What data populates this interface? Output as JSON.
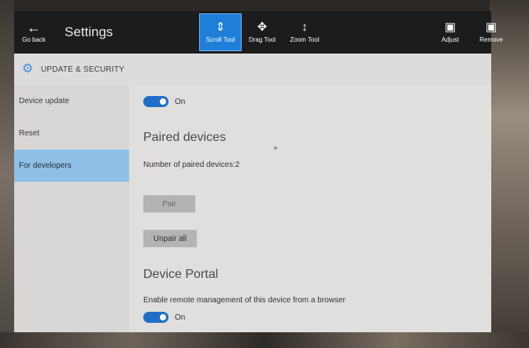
{
  "toolbar": {
    "go_back": "Go back",
    "title": "Settings",
    "tools": {
      "scroll": "Scroll Tool",
      "drag": "Drag Tool",
      "zoom": "Zoom Tool",
      "adjust": "Adjust",
      "remove": "Remove"
    },
    "active_tool": "scroll",
    "accent": "#1f7fd8"
  },
  "section": {
    "title": "UPDATE & SECURITY",
    "icon": "gear-icon"
  },
  "sidebar": {
    "items": [
      {
        "label": "Device update"
      },
      {
        "label": "Reset"
      },
      {
        "label": "For developers",
        "active": true
      }
    ]
  },
  "content": {
    "dev_mode_toggle": {
      "state": "On"
    },
    "paired_devices": {
      "heading": "Paired devices",
      "count_text": "Number of paired devices:2",
      "pair_button": "Pair",
      "unpair_button": "Unpair all"
    },
    "device_portal": {
      "heading": "Device Portal",
      "description": "Enable remote management of this device from a browser",
      "toggle_state": "On"
    }
  }
}
